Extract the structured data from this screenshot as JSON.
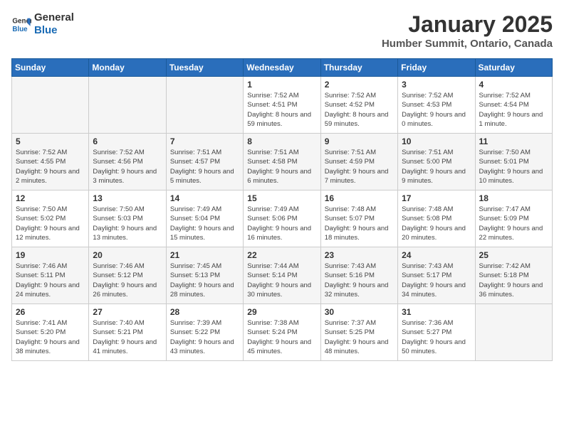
{
  "logo": {
    "line1": "General",
    "line2": "Blue"
  },
  "title": "January 2025",
  "location": "Humber Summit, Ontario, Canada",
  "headers": [
    "Sunday",
    "Monday",
    "Tuesday",
    "Wednesday",
    "Thursday",
    "Friday",
    "Saturday"
  ],
  "weeks": [
    [
      {
        "day": "",
        "content": ""
      },
      {
        "day": "",
        "content": ""
      },
      {
        "day": "",
        "content": ""
      },
      {
        "day": "1",
        "content": "Sunrise: 7:52 AM\nSunset: 4:51 PM\nDaylight: 8 hours and 59 minutes."
      },
      {
        "day": "2",
        "content": "Sunrise: 7:52 AM\nSunset: 4:52 PM\nDaylight: 8 hours and 59 minutes."
      },
      {
        "day": "3",
        "content": "Sunrise: 7:52 AM\nSunset: 4:53 PM\nDaylight: 9 hours and 0 minutes."
      },
      {
        "day": "4",
        "content": "Sunrise: 7:52 AM\nSunset: 4:54 PM\nDaylight: 9 hours and 1 minute."
      }
    ],
    [
      {
        "day": "5",
        "content": "Sunrise: 7:52 AM\nSunset: 4:55 PM\nDaylight: 9 hours and 2 minutes."
      },
      {
        "day": "6",
        "content": "Sunrise: 7:52 AM\nSunset: 4:56 PM\nDaylight: 9 hours and 3 minutes."
      },
      {
        "day": "7",
        "content": "Sunrise: 7:51 AM\nSunset: 4:57 PM\nDaylight: 9 hours and 5 minutes."
      },
      {
        "day": "8",
        "content": "Sunrise: 7:51 AM\nSunset: 4:58 PM\nDaylight: 9 hours and 6 minutes."
      },
      {
        "day": "9",
        "content": "Sunrise: 7:51 AM\nSunset: 4:59 PM\nDaylight: 9 hours and 7 minutes."
      },
      {
        "day": "10",
        "content": "Sunrise: 7:51 AM\nSunset: 5:00 PM\nDaylight: 9 hours and 9 minutes."
      },
      {
        "day": "11",
        "content": "Sunrise: 7:50 AM\nSunset: 5:01 PM\nDaylight: 9 hours and 10 minutes."
      }
    ],
    [
      {
        "day": "12",
        "content": "Sunrise: 7:50 AM\nSunset: 5:02 PM\nDaylight: 9 hours and 12 minutes."
      },
      {
        "day": "13",
        "content": "Sunrise: 7:50 AM\nSunset: 5:03 PM\nDaylight: 9 hours and 13 minutes."
      },
      {
        "day": "14",
        "content": "Sunrise: 7:49 AM\nSunset: 5:04 PM\nDaylight: 9 hours and 15 minutes."
      },
      {
        "day": "15",
        "content": "Sunrise: 7:49 AM\nSunset: 5:06 PM\nDaylight: 9 hours and 16 minutes."
      },
      {
        "day": "16",
        "content": "Sunrise: 7:48 AM\nSunset: 5:07 PM\nDaylight: 9 hours and 18 minutes."
      },
      {
        "day": "17",
        "content": "Sunrise: 7:48 AM\nSunset: 5:08 PM\nDaylight: 9 hours and 20 minutes."
      },
      {
        "day": "18",
        "content": "Sunrise: 7:47 AM\nSunset: 5:09 PM\nDaylight: 9 hours and 22 minutes."
      }
    ],
    [
      {
        "day": "19",
        "content": "Sunrise: 7:46 AM\nSunset: 5:11 PM\nDaylight: 9 hours and 24 minutes."
      },
      {
        "day": "20",
        "content": "Sunrise: 7:46 AM\nSunset: 5:12 PM\nDaylight: 9 hours and 26 minutes."
      },
      {
        "day": "21",
        "content": "Sunrise: 7:45 AM\nSunset: 5:13 PM\nDaylight: 9 hours and 28 minutes."
      },
      {
        "day": "22",
        "content": "Sunrise: 7:44 AM\nSunset: 5:14 PM\nDaylight: 9 hours and 30 minutes."
      },
      {
        "day": "23",
        "content": "Sunrise: 7:43 AM\nSunset: 5:16 PM\nDaylight: 9 hours and 32 minutes."
      },
      {
        "day": "24",
        "content": "Sunrise: 7:43 AM\nSunset: 5:17 PM\nDaylight: 9 hours and 34 minutes."
      },
      {
        "day": "25",
        "content": "Sunrise: 7:42 AM\nSunset: 5:18 PM\nDaylight: 9 hours and 36 minutes."
      }
    ],
    [
      {
        "day": "26",
        "content": "Sunrise: 7:41 AM\nSunset: 5:20 PM\nDaylight: 9 hours and 38 minutes."
      },
      {
        "day": "27",
        "content": "Sunrise: 7:40 AM\nSunset: 5:21 PM\nDaylight: 9 hours and 41 minutes."
      },
      {
        "day": "28",
        "content": "Sunrise: 7:39 AM\nSunset: 5:22 PM\nDaylight: 9 hours and 43 minutes."
      },
      {
        "day": "29",
        "content": "Sunrise: 7:38 AM\nSunset: 5:24 PM\nDaylight: 9 hours and 45 minutes."
      },
      {
        "day": "30",
        "content": "Sunrise: 7:37 AM\nSunset: 5:25 PM\nDaylight: 9 hours and 48 minutes."
      },
      {
        "day": "31",
        "content": "Sunrise: 7:36 AM\nSunset: 5:27 PM\nDaylight: 9 hours and 50 minutes."
      },
      {
        "day": "",
        "content": ""
      }
    ]
  ]
}
